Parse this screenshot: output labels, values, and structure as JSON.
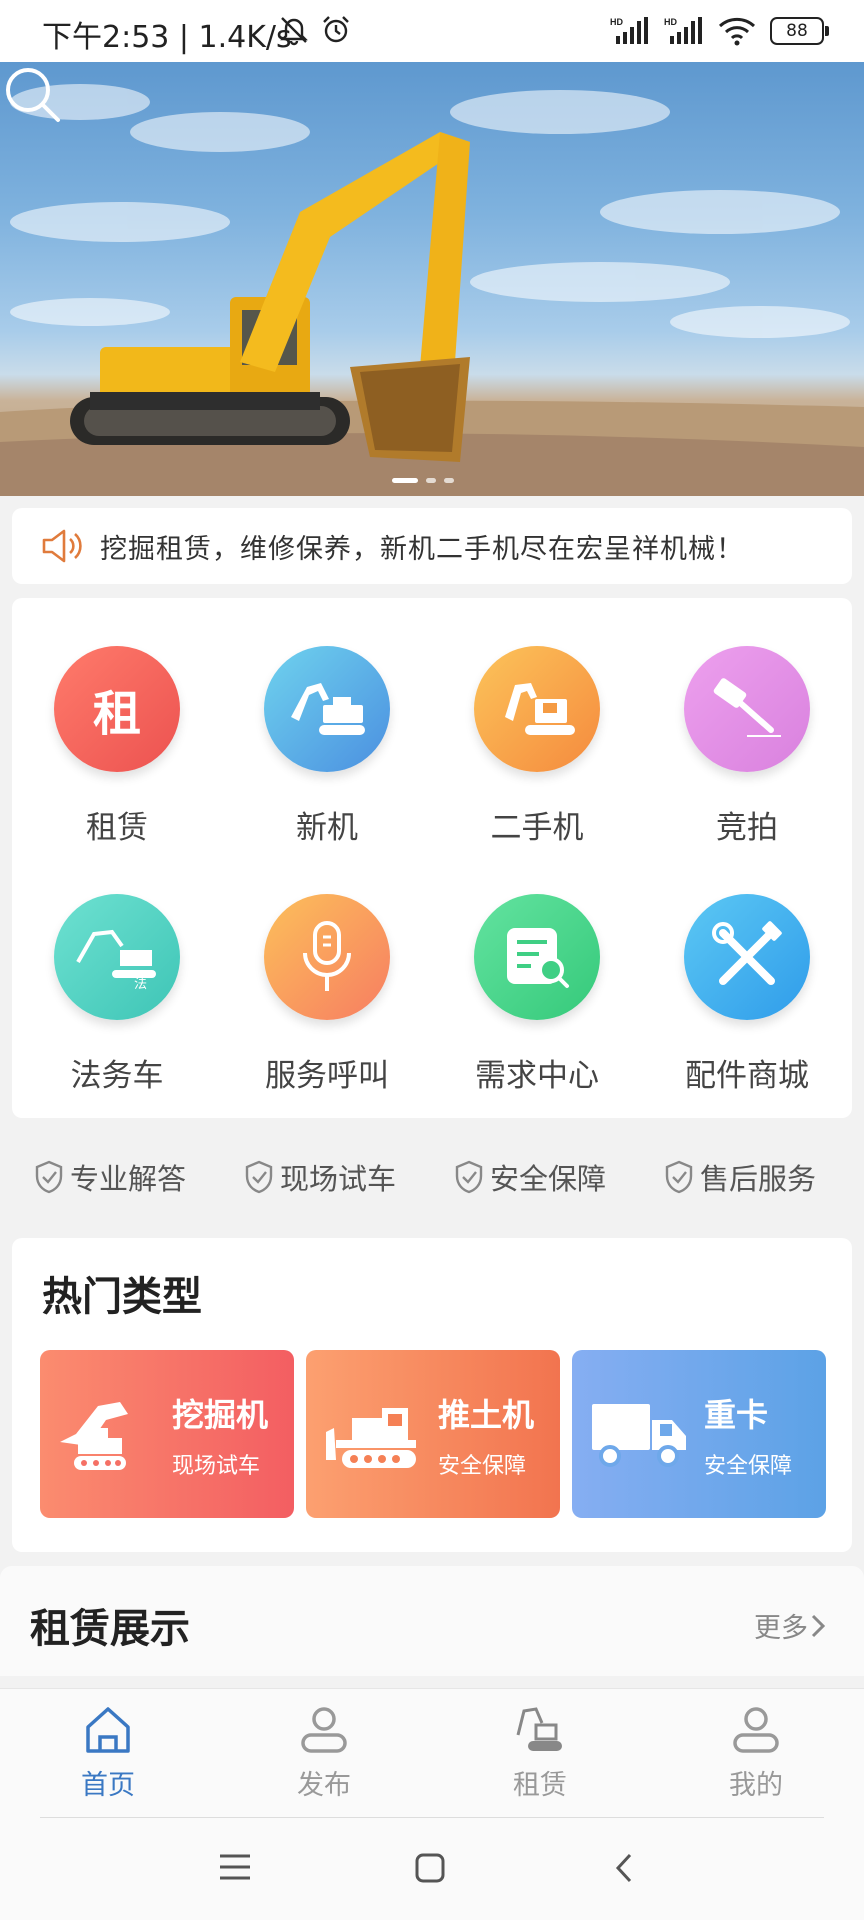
{
  "status_bar": {
    "time": "下午2:53 | 1.4K/s",
    "battery": "88"
  },
  "banner": {
    "slide_count": 3,
    "active_slide": 0
  },
  "notice": {
    "text": "挖掘租赁，维修保养，新机二手机尽在宏呈祥机械！"
  },
  "grid": {
    "items": [
      {
        "label": "租赁",
        "glyph": "租",
        "color": "#f0625a",
        "icon": "rent-icon"
      },
      {
        "label": "新机",
        "color": "#4fa8e8",
        "icon": "excavator-icon"
      },
      {
        "label": "二手机",
        "color": "#f8a14a",
        "icon": "excavator-icon"
      },
      {
        "label": "竞拍",
        "color": "#e28fe2",
        "icon": "hammer-icon"
      },
      {
        "label": "法务车",
        "color": "#4fd1c1",
        "icon": "legal-excavator-icon"
      },
      {
        "label": "服务呼叫",
        "color": "#f79b5f",
        "icon": "microphone-icon"
      },
      {
        "label": "需求中心",
        "color": "#4cd78a",
        "icon": "document-search-icon"
      },
      {
        "label": "配件商城",
        "color": "#3aaef0",
        "icon": "tools-icon"
      }
    ]
  },
  "features": [
    "专业解答",
    "现场试车",
    "安全保障",
    "售后服务"
  ],
  "hot_types": {
    "title": "热门类型",
    "tiles": [
      {
        "title": "挖掘机",
        "subtitle": "现场试车",
        "icon": "excavator-icon"
      },
      {
        "title": "推土机",
        "subtitle": "安全保障",
        "icon": "bulldozer-icon"
      },
      {
        "title": "重卡",
        "subtitle": "安全保障",
        "icon": "truck-icon"
      }
    ]
  },
  "rental": {
    "title": "租赁展示",
    "more_label": "更多"
  },
  "tabbar": {
    "tabs": [
      {
        "label": "首页",
        "active": true
      },
      {
        "label": "发布"
      },
      {
        "label": "租赁"
      },
      {
        "label": "我的"
      }
    ]
  }
}
